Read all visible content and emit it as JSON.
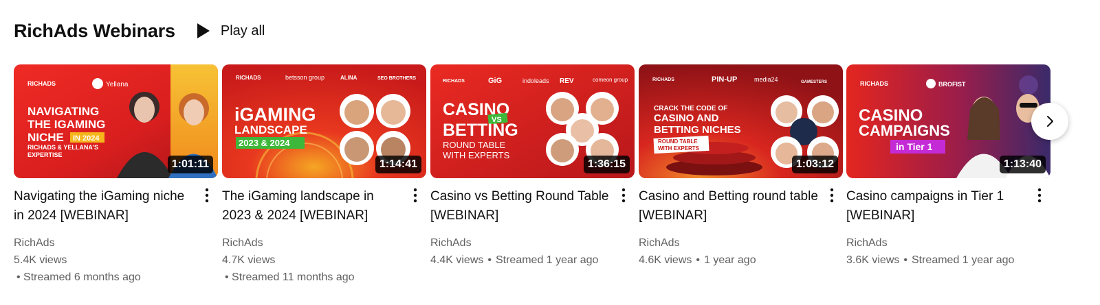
{
  "shelf": {
    "title": "RichAds Webinars",
    "play_all_label": "Play all",
    "next_icon": "chevron-right-icon"
  },
  "videos": [
    {
      "title": "Navigating the iGaming niche in 2024 [WEBINAR]",
      "duration": "1:01:11",
      "channel": "RichAds",
      "views": "5.4K views",
      "age": "• Streamed 6 months ago",
      "thumb_lines": [
        "NAVIGATING",
        "THE IGAMING",
        "NICHE",
        "IN 2024",
        "RICHADS & YELLANA'S",
        "EXPERTISE"
      ],
      "thumb_logos": [
        "RICHADS",
        "Yellana"
      ]
    },
    {
      "title": "The iGaming landscape in 2023 & 2024 [WEBINAR]",
      "duration": "1:14:41",
      "channel": "RichAds",
      "views": "4.7K views",
      "age": "• Streamed 11 months ago",
      "thumb_lines": [
        "iGAMING",
        "LANDSCAPE",
        "2023 & 2024"
      ],
      "thumb_logos": [
        "RICHADS",
        "betsson group",
        "ALINA",
        "SEO BROTHERS"
      ]
    },
    {
      "title": "Casino vs Betting Round Table [WEBINAR]",
      "duration": "1:36:15",
      "channel": "RichAds",
      "views": "4.4K views",
      "age": "Streamed 1 year ago",
      "thumb_lines": [
        "CASINO",
        "VS",
        "BETTING",
        "ROUND TABLE",
        "WITH EXPERTS"
      ],
      "thumb_logos": [
        "RICHADS",
        "GiG",
        "indoleads",
        "REV",
        "comeon group"
      ]
    },
    {
      "title": "Casino and Betting round table [WEBINAR]",
      "duration": "1:03:12",
      "channel": "RichAds",
      "views": "4.6K views",
      "age": "1 year ago",
      "thumb_lines": [
        "CRACK THE CODE OF",
        "CASINO AND",
        "BETTING NICHES",
        "ROUND TABLE",
        "WITH EXPERTS"
      ],
      "thumb_logos": [
        "RICHADS",
        "PIN-UP",
        "media24",
        "GAMESTERS"
      ]
    },
    {
      "title": "Casino campaigns in Tier 1 [WEBINAR]",
      "duration": "1:13:40",
      "channel": "RichAds",
      "views": "3.6K views",
      "age": "Streamed 1 year ago",
      "thumb_lines": [
        "CASINO",
        "CAMPAIGNS",
        "in Tier 1"
      ],
      "thumb_logos": [
        "RICHADS",
        "BROFIST"
      ]
    }
  ],
  "colors": {
    "title_text": "#0f0f0f",
    "meta_text": "#606060",
    "thumb_red": "#e52421",
    "accent_yellow": "#f6b61b",
    "accent_green": "#3db83a",
    "accent_purple": "#c42bd6"
  }
}
